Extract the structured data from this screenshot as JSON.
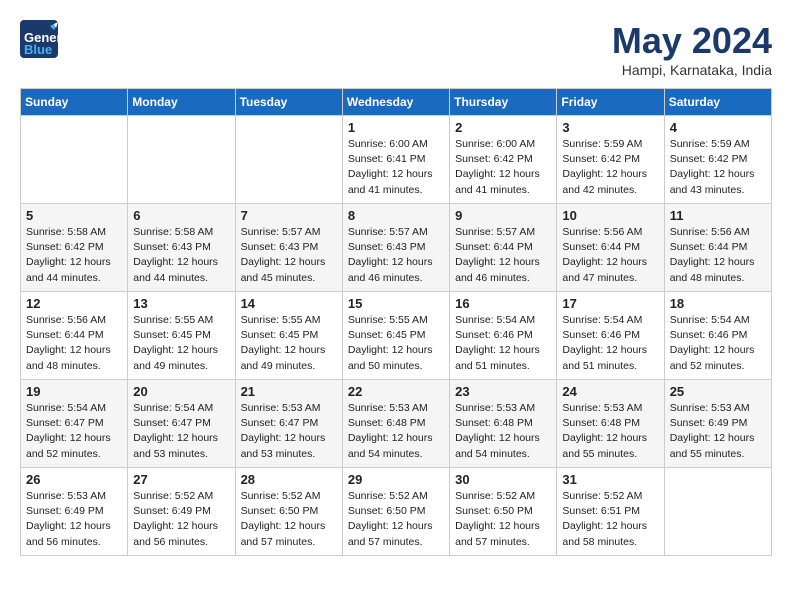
{
  "header": {
    "logo_line1": "General",
    "logo_line2": "Blue",
    "month": "May 2024",
    "location": "Hampi, Karnataka, India"
  },
  "weekdays": [
    "Sunday",
    "Monday",
    "Tuesday",
    "Wednesday",
    "Thursday",
    "Friday",
    "Saturday"
  ],
  "weeks": [
    [
      {
        "day": "",
        "detail": ""
      },
      {
        "day": "",
        "detail": ""
      },
      {
        "day": "",
        "detail": ""
      },
      {
        "day": "1",
        "detail": "Sunrise: 6:00 AM\nSunset: 6:41 PM\nDaylight: 12 hours\nand 41 minutes."
      },
      {
        "day": "2",
        "detail": "Sunrise: 6:00 AM\nSunset: 6:42 PM\nDaylight: 12 hours\nand 41 minutes."
      },
      {
        "day": "3",
        "detail": "Sunrise: 5:59 AM\nSunset: 6:42 PM\nDaylight: 12 hours\nand 42 minutes."
      },
      {
        "day": "4",
        "detail": "Sunrise: 5:59 AM\nSunset: 6:42 PM\nDaylight: 12 hours\nand 43 minutes."
      }
    ],
    [
      {
        "day": "5",
        "detail": "Sunrise: 5:58 AM\nSunset: 6:42 PM\nDaylight: 12 hours\nand 44 minutes."
      },
      {
        "day": "6",
        "detail": "Sunrise: 5:58 AM\nSunset: 6:43 PM\nDaylight: 12 hours\nand 44 minutes."
      },
      {
        "day": "7",
        "detail": "Sunrise: 5:57 AM\nSunset: 6:43 PM\nDaylight: 12 hours\nand 45 minutes."
      },
      {
        "day": "8",
        "detail": "Sunrise: 5:57 AM\nSunset: 6:43 PM\nDaylight: 12 hours\nand 46 minutes."
      },
      {
        "day": "9",
        "detail": "Sunrise: 5:57 AM\nSunset: 6:44 PM\nDaylight: 12 hours\nand 46 minutes."
      },
      {
        "day": "10",
        "detail": "Sunrise: 5:56 AM\nSunset: 6:44 PM\nDaylight: 12 hours\nand 47 minutes."
      },
      {
        "day": "11",
        "detail": "Sunrise: 5:56 AM\nSunset: 6:44 PM\nDaylight: 12 hours\nand 48 minutes."
      }
    ],
    [
      {
        "day": "12",
        "detail": "Sunrise: 5:56 AM\nSunset: 6:44 PM\nDaylight: 12 hours\nand 48 minutes."
      },
      {
        "day": "13",
        "detail": "Sunrise: 5:55 AM\nSunset: 6:45 PM\nDaylight: 12 hours\nand 49 minutes."
      },
      {
        "day": "14",
        "detail": "Sunrise: 5:55 AM\nSunset: 6:45 PM\nDaylight: 12 hours\nand 49 minutes."
      },
      {
        "day": "15",
        "detail": "Sunrise: 5:55 AM\nSunset: 6:45 PM\nDaylight: 12 hours\nand 50 minutes."
      },
      {
        "day": "16",
        "detail": "Sunrise: 5:54 AM\nSunset: 6:46 PM\nDaylight: 12 hours\nand 51 minutes."
      },
      {
        "day": "17",
        "detail": "Sunrise: 5:54 AM\nSunset: 6:46 PM\nDaylight: 12 hours\nand 51 minutes."
      },
      {
        "day": "18",
        "detail": "Sunrise: 5:54 AM\nSunset: 6:46 PM\nDaylight: 12 hours\nand 52 minutes."
      }
    ],
    [
      {
        "day": "19",
        "detail": "Sunrise: 5:54 AM\nSunset: 6:47 PM\nDaylight: 12 hours\nand 52 minutes."
      },
      {
        "day": "20",
        "detail": "Sunrise: 5:54 AM\nSunset: 6:47 PM\nDaylight: 12 hours\nand 53 minutes."
      },
      {
        "day": "21",
        "detail": "Sunrise: 5:53 AM\nSunset: 6:47 PM\nDaylight: 12 hours\nand 53 minutes."
      },
      {
        "day": "22",
        "detail": "Sunrise: 5:53 AM\nSunset: 6:48 PM\nDaylight: 12 hours\nand 54 minutes."
      },
      {
        "day": "23",
        "detail": "Sunrise: 5:53 AM\nSunset: 6:48 PM\nDaylight: 12 hours\nand 54 minutes."
      },
      {
        "day": "24",
        "detail": "Sunrise: 5:53 AM\nSunset: 6:48 PM\nDaylight: 12 hours\nand 55 minutes."
      },
      {
        "day": "25",
        "detail": "Sunrise: 5:53 AM\nSunset: 6:49 PM\nDaylight: 12 hours\nand 55 minutes."
      }
    ],
    [
      {
        "day": "26",
        "detail": "Sunrise: 5:53 AM\nSunset: 6:49 PM\nDaylight: 12 hours\nand 56 minutes."
      },
      {
        "day": "27",
        "detail": "Sunrise: 5:52 AM\nSunset: 6:49 PM\nDaylight: 12 hours\nand 56 minutes."
      },
      {
        "day": "28",
        "detail": "Sunrise: 5:52 AM\nSunset: 6:50 PM\nDaylight: 12 hours\nand 57 minutes."
      },
      {
        "day": "29",
        "detail": "Sunrise: 5:52 AM\nSunset: 6:50 PM\nDaylight: 12 hours\nand 57 minutes."
      },
      {
        "day": "30",
        "detail": "Sunrise: 5:52 AM\nSunset: 6:50 PM\nDaylight: 12 hours\nand 57 minutes."
      },
      {
        "day": "31",
        "detail": "Sunrise: 5:52 AM\nSunset: 6:51 PM\nDaylight: 12 hours\nand 58 minutes."
      },
      {
        "day": "",
        "detail": ""
      }
    ]
  ]
}
